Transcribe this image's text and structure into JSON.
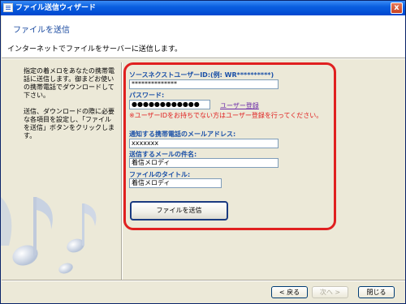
{
  "window": {
    "title": "ファイル送信ウィザード",
    "close_label": "x"
  },
  "header": {
    "title": "ファイルを送信",
    "subtitle": "インターネットでファイルをサーバーに送信します。"
  },
  "instructions": {
    "paragraph1": "指定の着メロをあなたの携帯電話に送信します。御まどお使いの携帯電話でダウンロードして下さい。",
    "paragraph2": "送信、ダウンロードの際に必要な各項目を設定し、「ファイルを送信」ボタンをクリックします。"
  },
  "form": {
    "user_id_label": "ソースネクストユーザーID:(例: WR**********)",
    "user_id_value": "**************",
    "password_label": "パスワード:",
    "password_value": "●●●●●●●●●●●●",
    "register_link": "ユーザー登録",
    "warning": "※ユーザーIDをお持ちでない方はユーザー登録を行ってください。",
    "email_label": "通知する携帯電話のメールアドレス:",
    "email_value": "xxxxxxx",
    "subject_label": "送信するメールの件名:",
    "subject_value": "着信メロディ",
    "file_title_label": "ファイルのタイトル:",
    "file_title_value": "着信メロディ",
    "send_button": "ファイルを送信"
  },
  "footer": {
    "back_button": "< 戻る",
    "next_button": "次へ >",
    "close_button": "閉じる"
  },
  "colors": {
    "highlight_border": "#e02020",
    "label_blue": "#1a50a8",
    "title_bar": "#0a5fe0"
  }
}
